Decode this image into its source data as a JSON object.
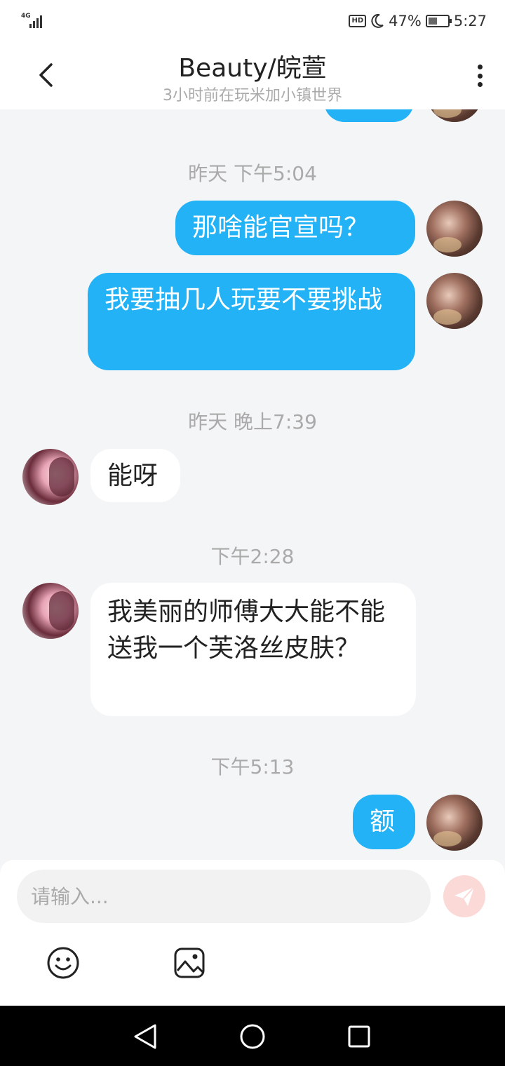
{
  "status_bar": {
    "network": "4G",
    "hd": "HD",
    "battery": "47%",
    "battery_level": 0.47,
    "time": "5:27"
  },
  "header": {
    "title": "Beauty/皖萱",
    "subtitle": "3小时前在玩米加小镇世界"
  },
  "messages": {
    "ts1": "昨天 下午5:04",
    "m1": "那啥能官宣吗？",
    "m2": "我要抽几人玩要不要挑战",
    "ts2": "昨天 晚上7:39",
    "m3": "能呀",
    "ts3": "下午2:28",
    "m4": "我美丽的师傅大大能不能送我一个芙洛丝皮肤？",
    "ts4": "下午5:13",
    "m5": "额"
  },
  "input": {
    "placeholder": "请输入..."
  },
  "icons": {
    "back": "chevron-left-icon",
    "more": "more-vertical-icon",
    "send": "send-icon",
    "emoji": "emoji-icon",
    "image": "image-icon"
  },
  "colors": {
    "accent": "#22b2f5",
    "background": "#f4f5f7",
    "send_disabled": "#fbd9d6"
  }
}
